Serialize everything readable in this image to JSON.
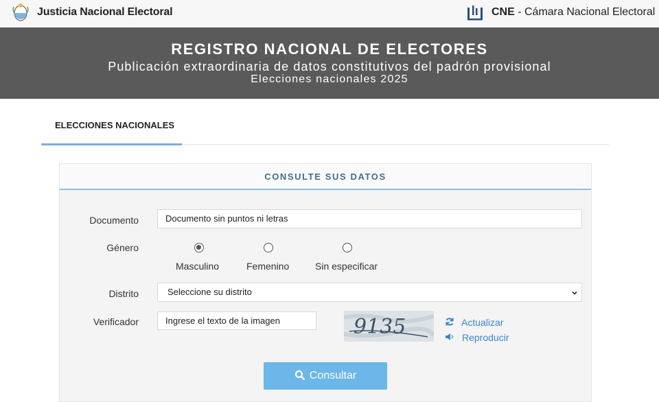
{
  "topbar": {
    "left_brand": "Justicia Nacional Electoral",
    "left_logo_icon": "argentina-coat-of-arms-icon",
    "right_brand_bold": "CNE",
    "right_brand_rest": " - Cámara Nacional Electoral",
    "right_logo_icon": "cne-building-icon"
  },
  "hero": {
    "title": "REGISTRO NACIONAL DE ELECTORES",
    "subtitle": "Publicación extraordinaria de datos constitutivos del padrón provisional",
    "subtitle2": "Elecciones nacionales 2025"
  },
  "tabs": [
    {
      "label": "ELECCIONES NACIONALES",
      "active": true
    }
  ],
  "form": {
    "header": "CONSULTE SUS DATOS",
    "documento": {
      "label": "Documento",
      "placeholder": "Documento sin puntos ni letras"
    },
    "genero": {
      "label": "Género",
      "options": [
        {
          "label": "Masculino",
          "selected": true
        },
        {
          "label": "Femenino",
          "selected": false
        },
        {
          "label": "Sin especificar",
          "selected": false
        }
      ]
    },
    "distrito": {
      "label": "Distrito",
      "selected": "Seleccione su distrito"
    },
    "verificador": {
      "label": "Verificador",
      "placeholder": "Ingrese el texto de la imagen",
      "captcha_text": "9135",
      "refresh_label": "Actualizar",
      "refresh_icon": "refresh-icon",
      "audio_label": "Reproducir",
      "audio_icon": "speaker-icon"
    },
    "submit": {
      "label": "Consultar",
      "icon": "search-icon"
    }
  },
  "colors": {
    "hero_bg": "#5a5a5a",
    "accent_blue": "#6cb6e8",
    "link_blue": "#3a86cc",
    "panel_title": "#3d6f8e"
  }
}
